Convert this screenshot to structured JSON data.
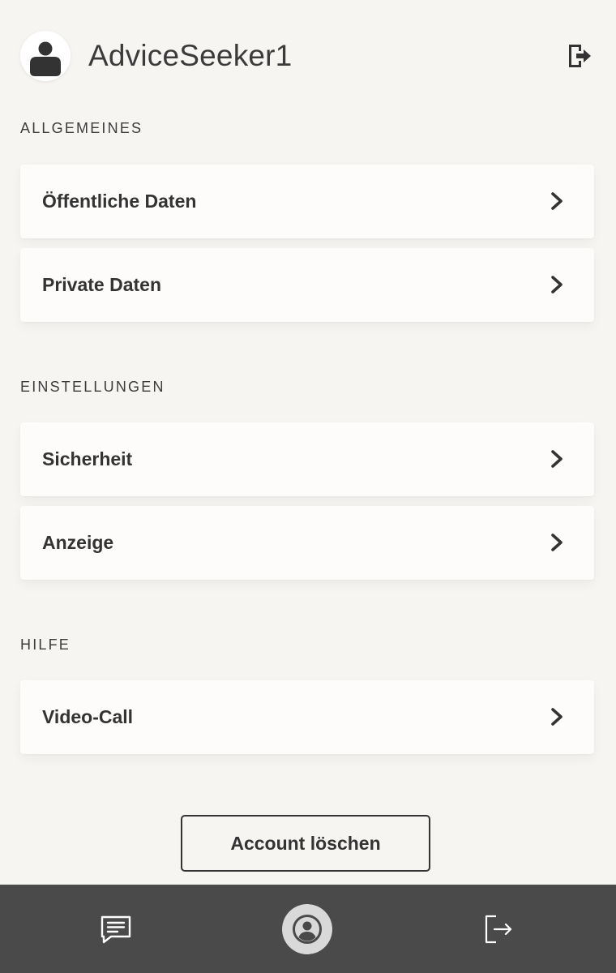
{
  "user": {
    "username": "AdviceSeeker1",
    "avatar_icon": "person-silhouette-icon"
  },
  "header": {
    "logout_icon": "logout-icon"
  },
  "sections": [
    {
      "label": "ALLGEMEINES",
      "items": [
        {
          "label": "Öffentliche Daten"
        },
        {
          "label": "Private Daten"
        }
      ]
    },
    {
      "label": "EINSTELLUNGEN",
      "items": [
        {
          "label": "Sicherheit"
        },
        {
          "label": "Anzeige"
        }
      ]
    },
    {
      "label": "HILFE",
      "items": [
        {
          "label": "Video-Call"
        }
      ]
    }
  ],
  "actions": {
    "delete_account_label": "Account löschen"
  },
  "bottom_nav": {
    "items": [
      {
        "icon": "messages-icon",
        "active": false
      },
      {
        "icon": "profile-icon",
        "active": true
      },
      {
        "icon": "logout-icon",
        "active": false
      }
    ]
  },
  "colors": {
    "background": "#f7f5f2",
    "card": "#fdfcfb",
    "text": "#333333",
    "nav_background": "#4a4a4a",
    "nav_active_circle": "#d9d9d9"
  }
}
